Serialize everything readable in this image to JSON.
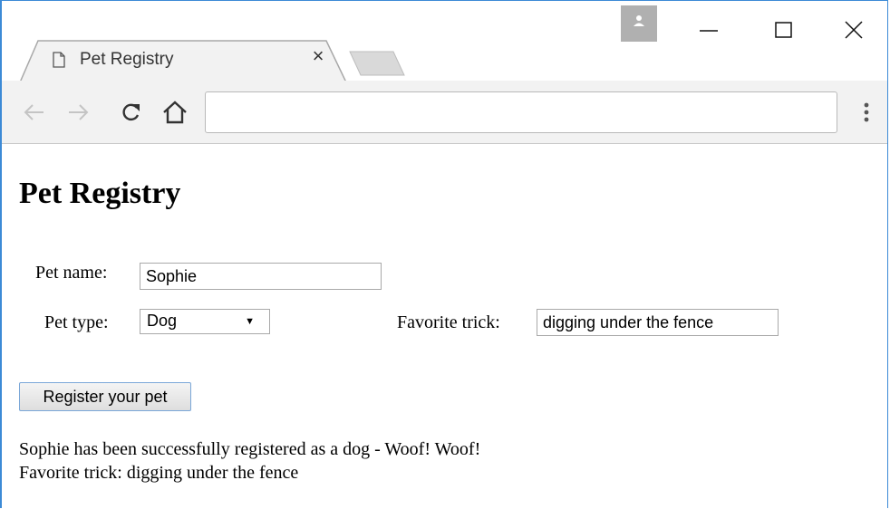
{
  "browser": {
    "tab": {
      "title": "Pet Registry",
      "close_glyph": "×",
      "icon": "page-icon"
    },
    "window_controls": {
      "minimize_icon": "minimize-icon",
      "maximize_icon": "maximize-icon",
      "close_icon": "close-icon"
    },
    "toolbar": {
      "address_value": "",
      "icons": [
        "back-arrow-icon",
        "forward-arrow-icon",
        "reload-icon",
        "home-icon",
        "menu-dots-icon"
      ]
    },
    "colors": {
      "window_border": "#3c8ad6",
      "toolbar_bg": "#f2f2f2",
      "profile_bg": "#b0b0b0"
    }
  },
  "page": {
    "heading": "Pet Registry",
    "form": {
      "pet_name_label": "Pet name:",
      "pet_name_value": "Sophie",
      "pet_type_label": "Pet type:",
      "pet_type_value": "Dog",
      "favorite_trick_label": "Favorite trick:",
      "favorite_trick_value": "digging under the fence",
      "submit_label": "Register your pet"
    },
    "result": {
      "line1": "Sophie has been successfully registered as a dog - Woof! Woof!",
      "line2": "Favorite trick: digging under the fence"
    }
  }
}
